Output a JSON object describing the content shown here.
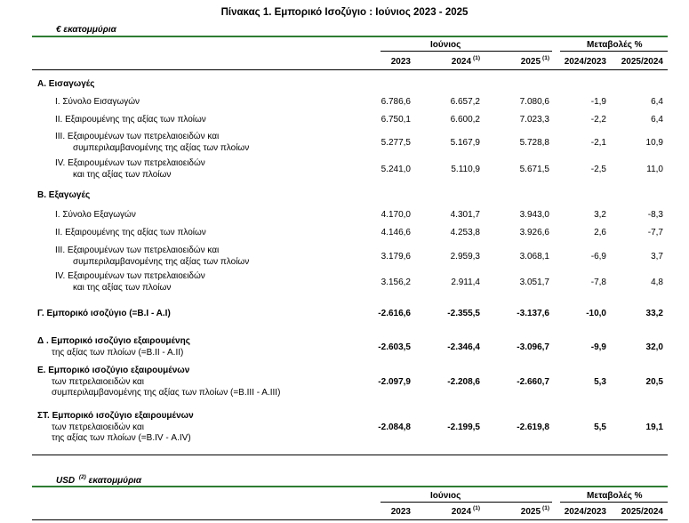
{
  "title": "Πίνακας 1. Εμπορικό Ισοζύγιο :  Ιούνιος 2023  - 2025",
  "unit_eur": "€ εκατομμύρια",
  "unit_usd_prefix": "USD",
  "unit_usd_sup": "(2)",
  "unit_usd_suffix": "εκατομμύρια",
  "header": {
    "month": "Ιούνιος",
    "changes": "Μεταβολές %",
    "y2023": "2023",
    "y2024": "2024",
    "y2024_sup": "(1)",
    "y2025": "2025",
    "y2025_sup": "(1)",
    "c1": "2024/2023",
    "c2": "2025/2024"
  },
  "sections": {
    "A": "Α. Εισαγωγές",
    "B": "Β. Εξαγωγές"
  },
  "rows": [
    {
      "lines": [
        "Ι.  Σύνολο Εισαγωγών"
      ],
      "v": [
        "6.786,6",
        "6.657,2",
        "7.080,6",
        "-1,9",
        "6,4"
      ]
    },
    {
      "lines": [
        "ΙΙ.  Εξαιρουμένης  της αξίας των πλοίων"
      ],
      "v": [
        "6.750,1",
        "6.600,2",
        "7.023,3",
        "-2,2",
        "6,4"
      ]
    },
    {
      "lines": [
        "ΙΙΙ. Εξαιρουμένων των πετρελαιοειδών και",
        "συμπεριλαμβανομένης της αξίας των πλοίων"
      ],
      "v": [
        "5.277,5",
        "5.167,9",
        "5.728,8",
        "-2,1",
        "10,9"
      ]
    },
    {
      "lines": [
        "ΙV. Εξαιρουμένων των πετρελαιοειδών",
        "και της αξίας των πλοίων"
      ],
      "v": [
        "5.241,0",
        "5.110,9",
        "5.671,5",
        "-2,5",
        "11,0"
      ]
    },
    {
      "lines": [
        "Ι.  Σύνολο Εξαγωγών"
      ],
      "v": [
        "4.170,0",
        "4.301,7",
        "3.943,0",
        "3,2",
        "-8,3"
      ]
    },
    {
      "lines": [
        "ΙΙ.  Εξαιρουμένης  της αξίας των πλοίων"
      ],
      "v": [
        "4.146,6",
        "4.253,8",
        "3.926,6",
        "2,6",
        "-7,7"
      ]
    },
    {
      "lines": [
        "ΙΙΙ. Εξαιρουμένων των πετρελαιοειδών και",
        "συμπεριλαμβανομένης της αξίας των πλοίων"
      ],
      "v": [
        "3.179,6",
        "2.959,3",
        "3.068,1",
        "-6,9",
        "3,7"
      ]
    },
    {
      "lines": [
        "ΙV. Εξαιρουμένων των πετρελαιοειδών",
        "και της αξίας των πλοίων"
      ],
      "v": [
        "3.156,2",
        "2.911,4",
        "3.051,7",
        "-7,8",
        "4,8"
      ]
    }
  ],
  "balances": [
    {
      "lines": [
        "Γ. Εμπορικό ισοζύγιο (=Β.Ι - Α.Ι)"
      ],
      "v": [
        "-2.616,6",
        "-2.355,5",
        "-3.137,6",
        "-10,0",
        "33,2"
      ]
    },
    {
      "lines": [
        "Δ . Εμπορικό ισοζύγιο εξαιρουμένης",
        "της αξίας των πλοίων (=Β.ΙΙ - Α.ΙΙ)"
      ],
      "v": [
        "-2.603,5",
        "-2.346,4",
        "-3.096,7",
        "-9,9",
        "32,0"
      ]
    },
    {
      "lines": [
        "Ε. Εμπορικό ισοζύγιο εξαιρουμένων",
        "των πετρελαιοειδών και",
        "συμπεριλαμβανομένης της αξίας των πλοίων (=Β.ΙΙΙ - Α.ΙΙΙ)"
      ],
      "v": [
        "-2.097,9",
        "-2.208,6",
        "-2.660,7",
        "5,3",
        "20,5"
      ]
    },
    {
      "lines": [
        "ΣΤ. Εμπορικό ισοζύγιο εξαιρουμένων",
        "των πετρελαιοειδών και",
        "της αξίας των πλοίων (=Β.ΙV - Α.ΙV)"
      ],
      "v": [
        "-2.084,8",
        "-2.199,5",
        "-2.619,8",
        "5,5",
        "19,1"
      ]
    }
  ]
}
